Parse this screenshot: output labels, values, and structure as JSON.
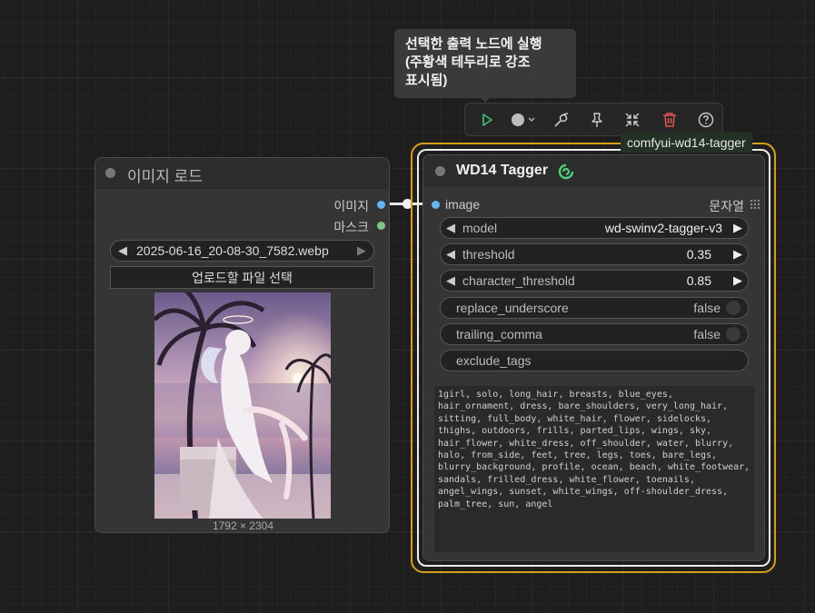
{
  "tooltip": {
    "line1": "선택한 출력 노드에 실행",
    "line2": "(주황색 테두리로 강조",
    "line3": "표시됨)"
  },
  "toolbar": {
    "buttons": [
      {
        "icon": "play-icon",
        "color": "#3fbf6f"
      },
      {
        "icon": "color-circle-icon",
        "color": "#bbbbbb"
      },
      {
        "icon": "bypass-icon",
        "color": "#cccccc"
      },
      {
        "icon": "pin-icon",
        "color": "#cccccc"
      },
      {
        "icon": "collapse-icon",
        "color": "#cccccc"
      },
      {
        "icon": "trash-icon",
        "color": "#e05555"
      },
      {
        "icon": "help-icon",
        "color": "#cccccc"
      }
    ]
  },
  "load_node": {
    "title": "이미지 로드",
    "outputs": [
      {
        "label": "이미지",
        "color": "#64b5f6"
      },
      {
        "label": "마스크",
        "color": "#81c784"
      }
    ],
    "image_combo": {
      "value": "2025-06-16_20-08-30_7582.webp"
    },
    "upload_label": "업로드할 파일 선택",
    "image_size": "1792 × 2304"
  },
  "tagger_node": {
    "badge": "comfyui-wd14-tagger",
    "title": "WD14 Tagger",
    "input_label": "image",
    "output_label": "문자열",
    "widgets": {
      "model": {
        "label": "model",
        "value": "wd-swinv2-tagger-v3"
      },
      "threshold": {
        "label": "threshold",
        "value": "0.35"
      },
      "character_threshold": {
        "label": "character_threshold",
        "value": "0.85"
      },
      "replace_underscore": {
        "label": "replace_underscore",
        "value": "false"
      },
      "trailing_comma": {
        "label": "trailing_comma",
        "value": "false"
      },
      "exclude_tags": {
        "label": "exclude_tags"
      }
    },
    "tags_text": "1girl, solo, long_hair, breasts, blue_eyes,\nhair_ornament, dress, bare_shoulders, very_long_hair,\nsitting, full_body, white_hair, flower, sidelocks,\nthighs, outdoors, frills, parted_lips, wings, sky,\nhair_flower, white_dress, off_shoulder, water, blurry,\nhalo, from_side, feet, tree, legs, toes, bare_legs,\nblurry_background, profile, ocean, beach, white_footwear,\nsandals, frilled_dress, white_flower, toenails,\nangel_wings, sunset, white_wings, off-shoulder_dress,\npalm_tree, sun, angel",
    "accent_color": "#d4a017"
  }
}
